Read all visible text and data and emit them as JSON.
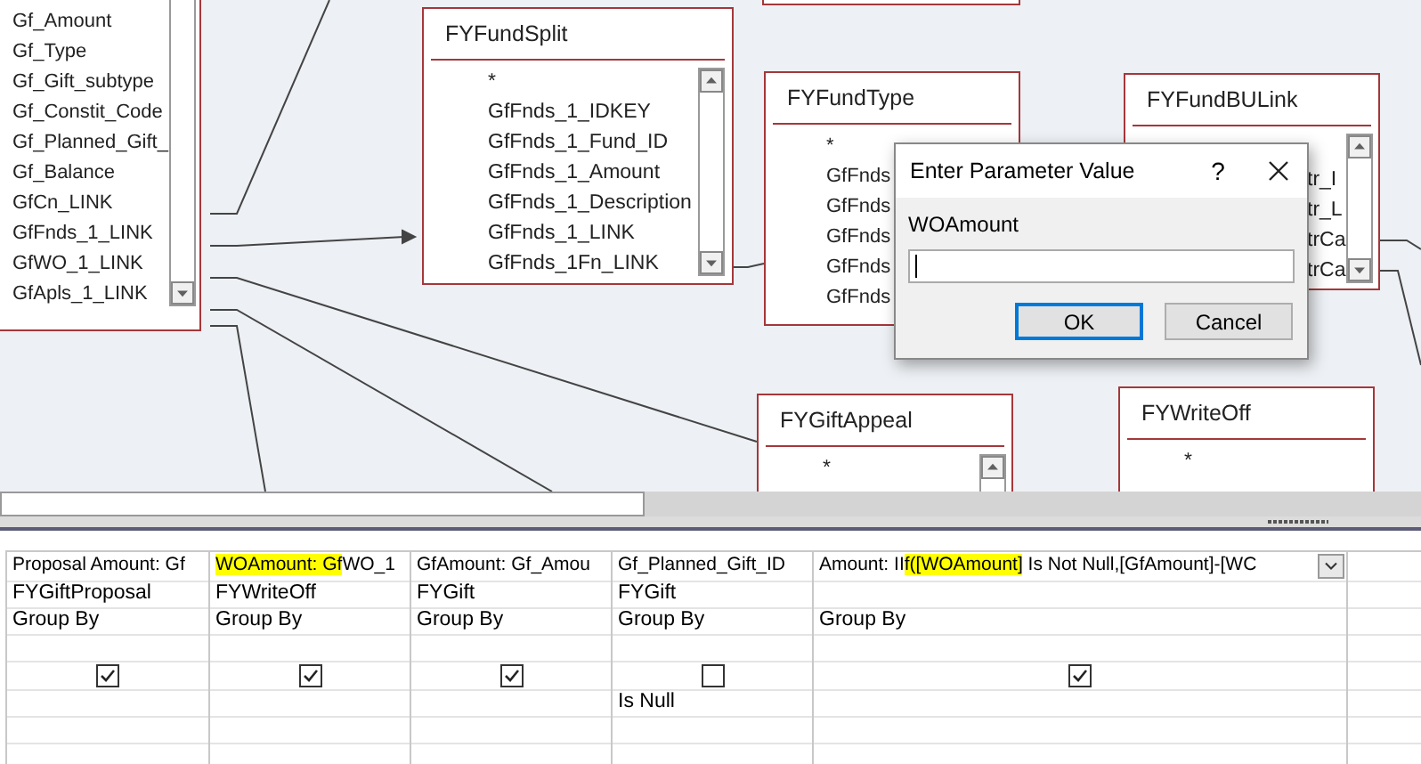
{
  "tables": [
    {
      "fields": [
        "Gf_Amount",
        "Gf_Type",
        "Gf_Gift_subtype",
        "Gf_Constit_Code",
        "Gf_Planned_Gift_",
        "Gf_Balance",
        "GfCn_LINK",
        "GfFnds_1_LINK",
        "GfWO_1_LINK",
        "GfApls_1_LINK"
      ]
    },
    {
      "title": "FYFundSplit",
      "fields": [
        "*",
        "GfFnds_1_IDKEY",
        "GfFnds_1_Fund_ID",
        "GfFnds_1_Amount",
        "GfFnds_1_Description",
        "GfFnds_1_LINK",
        "GfFnds_1Fn_LINK"
      ]
    },
    {
      "title": "FYFundType",
      "fields": [
        "*",
        "GfFnds",
        "GfFnds",
        "GfFnds",
        "GfFnds",
        "GfFnds"
      ]
    },
    {
      "title": "FYFundBULink",
      "fields": [
        "tr_I",
        "tr_L",
        "trCa",
        "trCa"
      ]
    },
    {
      "title": "FYGiftAppeal",
      "fields": [
        "*"
      ]
    },
    {
      "title": "FYWriteOff",
      "fields": [
        "*"
      ]
    }
  ],
  "dialog": {
    "title": "Enter Parameter Value",
    "help": "?",
    "prompt": "WOAmount",
    "buttons": [
      {
        "label": "OK",
        "selected": true
      },
      {
        "label": "Cancel",
        "selected": false
      }
    ]
  },
  "grid": {
    "columns": [
      {
        "field": [
          {
            "text": "Proposal Amount: Gf",
            "highlighted": false
          }
        ],
        "table": "FYGiftProposal",
        "total": "Group By",
        "show": true
      },
      {
        "field": [
          {
            "text": "WOAmount: Gf",
            "highlighted": true
          },
          {
            "text": "WO_1",
            "highlighted": false
          }
        ],
        "table": "FYWriteOff",
        "total": "Group By",
        "show": true
      },
      {
        "field": [
          {
            "text": "GfAmount: Gf_Amou",
            "highlighted": false
          }
        ],
        "table": "FYGift",
        "total": "Group By",
        "show": true
      },
      {
        "field": [
          {
            "text": "Gf_Planned_Gift_ID",
            "highlighted": false
          }
        ],
        "table": "FYGift",
        "total": "Group By",
        "show": false,
        "criteria": "Is Null"
      },
      {
        "field": [
          {
            "text": "Amount: II",
            "highlighted": false
          },
          {
            "text": "f([WOAmount]",
            "highlighted": true
          },
          {
            "text": " Is Not Null,[GfAmount]-[WC",
            "highlighted": false
          }
        ],
        "total": "Group By",
        "show": true,
        "dropdown": true
      },
      {}
    ]
  }
}
